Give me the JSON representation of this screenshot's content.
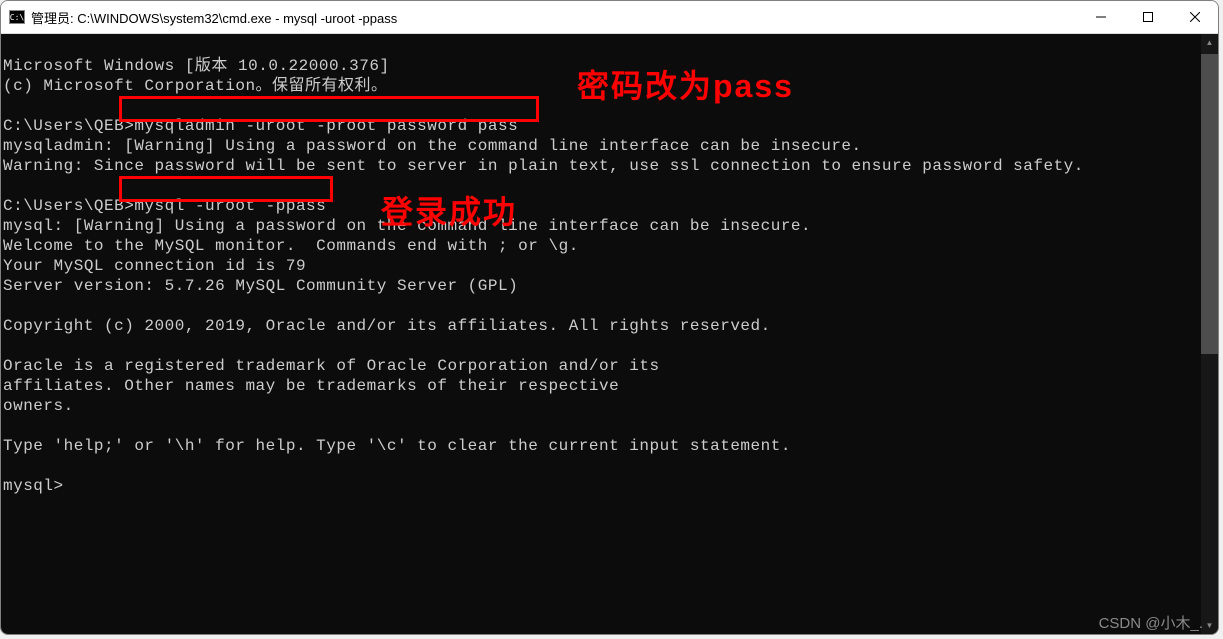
{
  "window": {
    "icon_text": "C:\\",
    "title": "管理员: C:\\WINDOWS\\system32\\cmd.exe - mysql  -uroot -ppass"
  },
  "terminal": {
    "line1": "Microsoft Windows [版本 10.0.22000.376]",
    "line2": "(c) Microsoft Corporation。保留所有权利。",
    "line3": "",
    "line4_prompt": "C:\\Users\\QEB>",
    "line4_cmd": "mysqladmin -uroot -proot password pass",
    "line5": "mysqladmin: [Warning] Using a password on the command line interface can be insecure.",
    "line6": "Warning: Since password will be sent to server in plain text, use ssl connection to ensure password safety.",
    "line7": "",
    "line8_prompt": "C:\\Users\\QEB>",
    "line8_cmd": "mysql -uroot -ppass",
    "line9": "mysql: [Warning] Using a password on the command line interface can be insecure.",
    "line10": "Welcome to the MySQL monitor.  Commands end with ; or \\g.",
    "line11": "Your MySQL connection id is 79",
    "line12": "Server version: 5.7.26 MySQL Community Server (GPL)",
    "line13": "",
    "line14": "Copyright (c) 2000, 2019, Oracle and/or its affiliates. All rights reserved.",
    "line15": "",
    "line16": "Oracle is a registered trademark of Oracle Corporation and/or its",
    "line17": "affiliates. Other names may be trademarks of their respective",
    "line18": "owners.",
    "line19": "",
    "line20": "Type 'help;' or '\\h' for help. Type '\\c' to clear the current input statement.",
    "line21": "",
    "line22": "mysql>"
  },
  "annotations": {
    "ann1": "密码改为pass",
    "ann2": "登录成功"
  },
  "watermark": "CSDN @小木_."
}
